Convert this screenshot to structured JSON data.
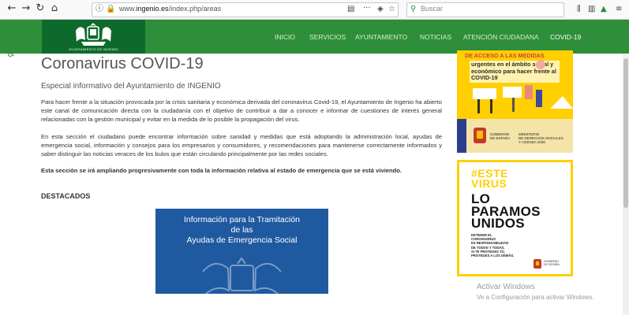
{
  "browser": {
    "url_prefix": "www.",
    "url_domain": "ingenio.es",
    "url_path": "/index.php/areas",
    "search_placeholder": "Buscar"
  },
  "site": {
    "logo_caption": "AYUNTAMIENTO DE INGENIO",
    "menu": [
      "INICIO",
      "SERVICIOS",
      "AYUNTAMIENTO",
      "NOTICIAS",
      "ATENCIÓN CIUDADANA",
      "COVID-19"
    ],
    "active_menu": "COVID-19",
    "brand_color": "#2f8e3a"
  },
  "main": {
    "title": "Coronavirus COVID-19",
    "subtitle": "Especial informativo del Ayuntamiento de INGENIO",
    "p1": "Para hacer frente a la situación provocada por la crisis sanitaria y económica derivada del coronavirus Covid-19, el Ayuntamiento de Ingenio ha abierto este canal de comunicación directa con la ciudadanía con el objetivo de contribuir a dar a conocer e informar de cuestiones de interés general relacionadas con la gestión municipal y evitar en la medida de lo posible la propagación del virus.",
    "p2": "En esta sección el ciudadano puede encontrar información sobre sanidad y medidas que está adoptando la administración local, ayudas de emergencia social, información y consejos para los empresarios y consumidores, y recomendaciones para mantenerse correctamente informados y saber distinguir las noticias veraces de los bulos que están circulando principalmente por las redes sociales.",
    "p3": "Esta sección se irá ampliando progresivamente con toda la información relativa al estado de emergencia que se está viviendo.",
    "destacados": "DESTACADOS",
    "banner_lines": [
      "Información para la Tramitación",
      "de las",
      "Ayudas de Emergencia Social"
    ]
  },
  "sidebar": {
    "ad1_header": "DE ACCESO A LAS MEDIDAS",
    "ad1_body": "urgentes en el ámbito social y económico para hacer frente al COVID-19",
    "ad1_gov": [
      "GOBIERNO",
      "DE ESPAÑA"
    ],
    "ad1_ministry": [
      "MINISTERIO",
      "DE DERECHOS SOCIALES",
      "Y AGENDA 2030"
    ],
    "ad2_tag": [
      "#ESTE",
      "VIRUS"
    ],
    "ad2_big": [
      "LO",
      "PARAMOS",
      "UNIDOS"
    ],
    "ad2_small": [
      "DETENER EL",
      "CORONAVIRUS",
      "ES RESPONSABILIDAD",
      "DE TODOS Y TODAS.",
      "SI TE PROTEGES TÚ,",
      "PROTEGES A LOS DEMÁS."
    ],
    "ad2_gov": [
      "GOBIERNO",
      "DE ESPAÑA"
    ]
  },
  "os": {
    "activate_title": "Activar Windows",
    "activate_sub": "Ve a Configuración para activar Windows."
  }
}
